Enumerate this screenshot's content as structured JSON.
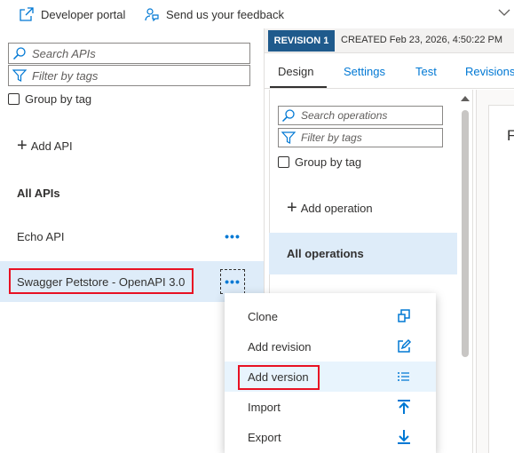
{
  "toolbar": {
    "developer_portal": "Developer portal",
    "feedback": "Send us your feedback"
  },
  "left": {
    "search_placeholder": "Search APIs",
    "filter_placeholder": "Filter by tags",
    "group_by_tag": "Group by tag",
    "add_api": "Add API",
    "section_title": "All APIs",
    "apis": [
      {
        "name": "Echo API",
        "more": "•••"
      },
      {
        "name": "Swagger Petstore - OpenAPI 3.0",
        "more": "•••"
      }
    ]
  },
  "revision": {
    "badge": "REVISION 1",
    "created": "CREATED Feb 23, 2026, 4:50:22 PM"
  },
  "tabs": [
    {
      "label": "Design"
    },
    {
      "label": "Settings"
    },
    {
      "label": "Test"
    },
    {
      "label": "Revisions"
    }
  ],
  "operations": {
    "search_placeholder": "Search operations",
    "filter_placeholder": "Filter by tags",
    "group_by_tag": "Group by tag",
    "add_operation": "Add operation",
    "all_operations": "All operations"
  },
  "design": {
    "letter": "F"
  },
  "context_menu": {
    "items": [
      {
        "label": "Clone",
        "icon": "clone-icon"
      },
      {
        "label": "Add revision",
        "icon": "edit-icon"
      },
      {
        "label": "Add version",
        "icon": "list-icon"
      },
      {
        "label": "Import",
        "icon": "import-icon"
      },
      {
        "label": "Export",
        "icon": "export-icon"
      }
    ]
  },
  "colors": {
    "accent": "#0078d4",
    "selected_bg": "#deecf9",
    "revision_badge": "#1f5a8c",
    "highlight_red": "#e81123"
  }
}
